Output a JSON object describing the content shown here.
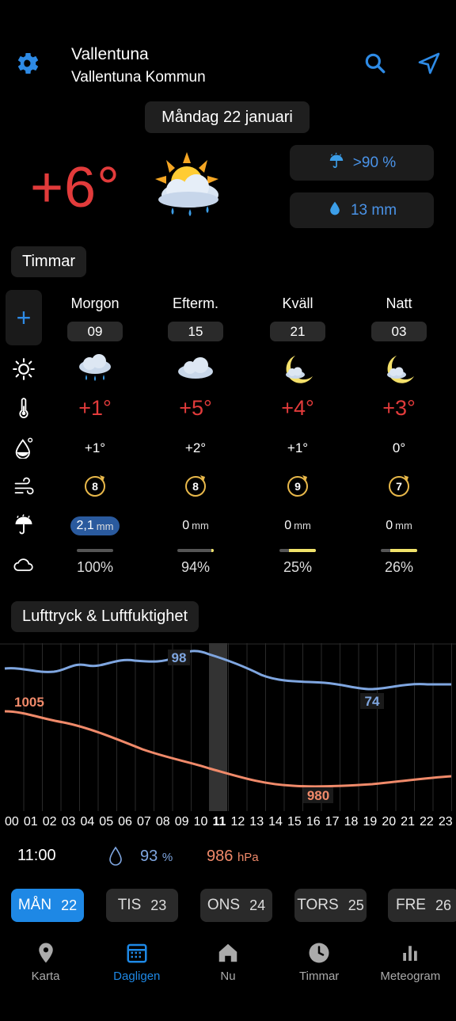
{
  "header": {
    "location_name": "Vallentuna",
    "location_sub": "Vallentuna Kommun",
    "date": "Måndag 22 januari"
  },
  "current": {
    "temp": "+6°",
    "precip_prob": ">90 %",
    "precip_amount": "13 mm",
    "icon": "sun-cloud-rain-icon"
  },
  "sections": {
    "hours_title": "Timmar",
    "graph_title": "Lufttryck & Luftfuktighet"
  },
  "periods": [
    {
      "label": "Morgon",
      "hour": "09",
      "icon": "cloud-rain-icon",
      "temp": "+1°",
      "feels": "+1°",
      "wind": "8",
      "precip_value": "2,1",
      "precip_unit": "mm",
      "highlight": true,
      "cloud_frac": 0.0,
      "cloud": "100%"
    },
    {
      "label": "Efterm.",
      "hour": "15",
      "icon": "cloud-icon",
      "temp": "+5°",
      "feels": "+2°",
      "wind": "8",
      "precip_value": "0",
      "precip_unit": "mm",
      "highlight": false,
      "cloud_frac": 0.06,
      "cloud": "94%"
    },
    {
      "label": "Kväll",
      "hour": "21",
      "icon": "moon-cloud-icon",
      "temp": "+4°",
      "feels": "+1°",
      "wind": "9",
      "precip_value": "0",
      "precip_unit": "mm",
      "highlight": false,
      "cloud_frac": 0.75,
      "cloud": "25%"
    },
    {
      "label": "Natt",
      "hour": "03",
      "icon": "moon-cloud-icon",
      "temp": "+3°",
      "feels": "0°",
      "wind": "7",
      "precip_value": "0",
      "precip_unit": "mm",
      "highlight": false,
      "cloud_frac": 0.74,
      "cloud": "26%"
    }
  ],
  "graph": {
    "humidity_label_high": "98",
    "humidity_label_low": "74",
    "pressure_label_high": "1005",
    "pressure_label_low": "980",
    "hours": [
      "00",
      "01",
      "02",
      "03",
      "04",
      "05",
      "06",
      "07",
      "08",
      "09",
      "10",
      "11",
      "12",
      "13",
      "14",
      "15",
      "16",
      "17",
      "18",
      "19",
      "20",
      "21",
      "22",
      "23"
    ],
    "current_hour": "11",
    "humidity_color": "#7fa6e0",
    "pressure_color": "#f08a6a"
  },
  "now": {
    "time": "11:00",
    "humidity_value": "93",
    "humidity_unit": "%",
    "pressure_value": "986",
    "pressure_unit": "hPa"
  },
  "days": [
    {
      "name": "MÅN",
      "num": "22",
      "active": true
    },
    {
      "name": "TIS",
      "num": "23",
      "active": false
    },
    {
      "name": "ONS",
      "num": "24",
      "active": false
    },
    {
      "name": "TORS",
      "num": "25",
      "active": false
    },
    {
      "name": "FRE",
      "num": "26",
      "active": false
    }
  ],
  "bottom_nav": [
    {
      "label": "Karta",
      "icon": "map-pin-icon",
      "active": false
    },
    {
      "label": "Dagligen",
      "icon": "calendar-icon",
      "active": true
    },
    {
      "label": "Nu",
      "icon": "home-icon",
      "active": false
    },
    {
      "label": "Timmar",
      "icon": "clock-icon",
      "active": false
    },
    {
      "label": "Meteogram",
      "icon": "bar-chart-icon",
      "active": false
    }
  ],
  "colors": {
    "accent": "#1e88e5",
    "warm_temp": "#e23b3b",
    "precip_blue": "#4a93e8"
  }
}
